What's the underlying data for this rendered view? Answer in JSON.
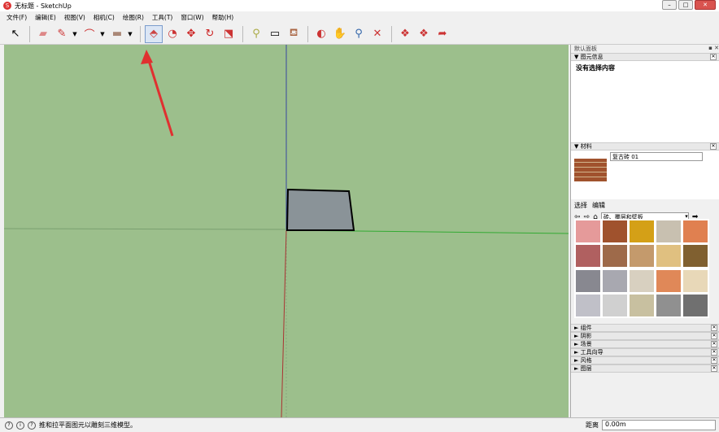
{
  "window": {
    "title": "无标题 - SketchUp"
  },
  "menu": [
    "文件(F)",
    "编辑(E)",
    "视图(V)",
    "相机(C)",
    "绘图(R)",
    "工具(T)",
    "窗口(W)",
    "帮助(H)"
  ],
  "panel": {
    "title": "默认面板",
    "entity_info": {
      "header": "图元信息",
      "body": "没有选择内容"
    },
    "materials": {
      "header": "材料",
      "name": "复古砖 01",
      "tab_select": "选择",
      "tab_edit": "编辑",
      "category": "砖、覆层和壁板",
      "swatch_colors": [
        "#e59a9a",
        "#a0522d",
        "#d4a017",
        "#c8c0b0",
        "#e08050",
        "#b06060",
        "#9e6a4a",
        "#c49a6c",
        "#e0c080",
        "#806030",
        "#888890",
        "#a8a8b0",
        "#d8d0c0",
        "#e08858",
        "#e8d8b8",
        "#c0c0c8",
        "#d0d0d0",
        "#c8c0a0",
        "#909090",
        "#707070"
      ]
    },
    "collapsed": [
      "组件",
      "阴影",
      "场景",
      "工具向导",
      "风格",
      "图层"
    ]
  },
  "status": {
    "hint": "推和拉平面图元以雕刻三维模型。",
    "measure_label": "距离",
    "measure_value": "0.00m"
  }
}
